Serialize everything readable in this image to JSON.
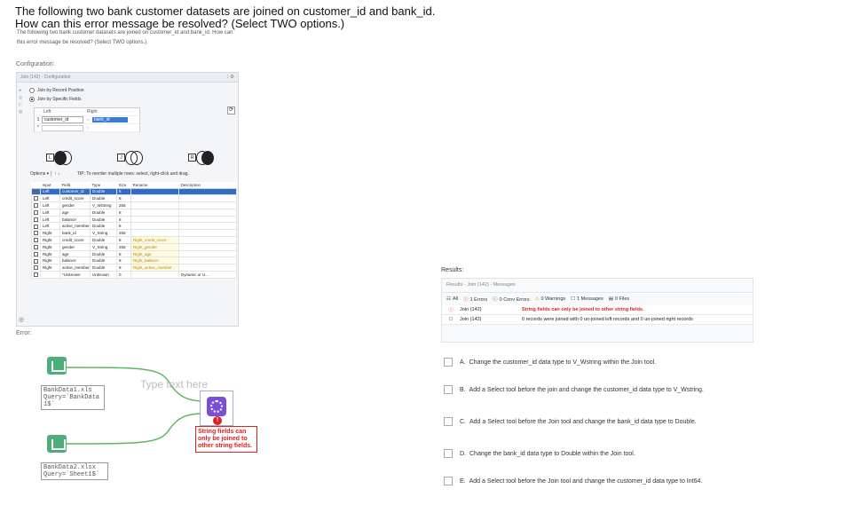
{
  "question": {
    "line1": "The following two bank customer datasets are joined on customer_id and bank_id.",
    "line2": "How can this error message be resolved? (Select TWO options.)",
    "small1": "The following two bank customer datasets are joined on customer_id and bank_id. How can",
    "small2": "this error message be resolved? (Select TWO options.)"
  },
  "labels": {
    "configuration": "Configuration:",
    "error": "Error:",
    "results": "Results:"
  },
  "config": {
    "header": "Join (142) - Configuration",
    "radio1": "Join by Record Position",
    "radio2": "Join by Specific Fields",
    "col_left": "Left",
    "col_right": "Right",
    "join_left": "customer_id",
    "join_right": "bank_id",
    "join_sym": "⇔",
    "options_label": "Options ▾ │ ↑ ↓",
    "tip": "TIP: To reorder multiple rows: select, right-click and drag.",
    "toggle_labels": [
      "L",
      "J",
      "R"
    ],
    "table_headers": [
      "Input",
      "Field",
      "Type",
      "Size",
      "Rename",
      "Description"
    ],
    "rows": [
      {
        "input": "Left",
        "field": "customer_id",
        "type": "Double",
        "size": "8",
        "rename": "",
        "desc": ""
      },
      {
        "input": "Left",
        "field": "credit_score",
        "type": "Double",
        "size": "8",
        "rename": "",
        "desc": ""
      },
      {
        "input": "Left",
        "field": "gender",
        "type": "V_WString",
        "size": "255",
        "rename": "",
        "desc": ""
      },
      {
        "input": "Left",
        "field": "age",
        "type": "Double",
        "size": "8",
        "rename": "",
        "desc": ""
      },
      {
        "input": "Left",
        "field": "balance",
        "type": "Double",
        "size": "8",
        "rename": "",
        "desc": ""
      },
      {
        "input": "Left",
        "field": "active_member",
        "type": "Double",
        "size": "8",
        "rename": "",
        "desc": ""
      },
      {
        "input": "Right",
        "field": "bank_id",
        "type": "V_String",
        "size": "255",
        "rename": "",
        "desc": ""
      },
      {
        "input": "Right",
        "field": "credit_score",
        "type": "Double",
        "size": "8",
        "rename": "Right_credit_score",
        "desc": ""
      },
      {
        "input": "Right",
        "field": "gender",
        "type": "V_String",
        "size": "255",
        "rename": "Right_gender",
        "desc": ""
      },
      {
        "input": "Right",
        "field": "age",
        "type": "Double",
        "size": "8",
        "rename": "Right_age",
        "desc": ""
      },
      {
        "input": "Right",
        "field": "balance",
        "type": "Double",
        "size": "8",
        "rename": "Right_balance",
        "desc": ""
      },
      {
        "input": "Right",
        "field": "active_member",
        "type": "Double",
        "size": "8",
        "rename": "Right_active_member",
        "desc": ""
      },
      {
        "input": "",
        "field": "*Unknown",
        "type": "Unknown",
        "size": "0",
        "rename": "",
        "desc": "Dynamic or U..."
      }
    ]
  },
  "workflow": {
    "node1": "BankData1.xls\nQuery=`BankData\n1$`",
    "node2": "BankData2.xlsx\nQuery=`Sheet1$`",
    "typetext": "Type text here",
    "join_error": "String fields can only be joined to other string fields."
  },
  "results": {
    "header": "Results - Join (142) - Messages",
    "filters": [
      "All",
      "1 Errors",
      "0 Conv Errors",
      "0 Warnings",
      "1 Messages",
      "0 Files"
    ],
    "rows": [
      {
        "tool": "Join (142)",
        "msg": "String fields can only be joined to other string fields.",
        "error": true
      },
      {
        "tool": "Join (142)",
        "msg": "0 records were joined with 0 un-joined left records and 0 un-joined right records",
        "error": false
      }
    ]
  },
  "options": [
    {
      "letter": "A.",
      "text": "Change the customer_id data type to V_Wstring within the Join tool."
    },
    {
      "letter": "B.",
      "text": "Add a Select tool before the join and change the customer_id data type to V_Wstring."
    },
    {
      "letter": "C.",
      "text": "Add a Select tool before the Join tool and change the bank_id data type to Double."
    },
    {
      "letter": "D.",
      "text": "Change the bank_id data type to Double within the Join tool."
    },
    {
      "letter": "E.",
      "text": "Add a Select tool before the Join tool and change the customer_id data type to Int64."
    }
  ],
  "colors": {
    "accent": "#2e6ec9",
    "error": "#d22222",
    "tool_green": "#4caf7a"
  }
}
